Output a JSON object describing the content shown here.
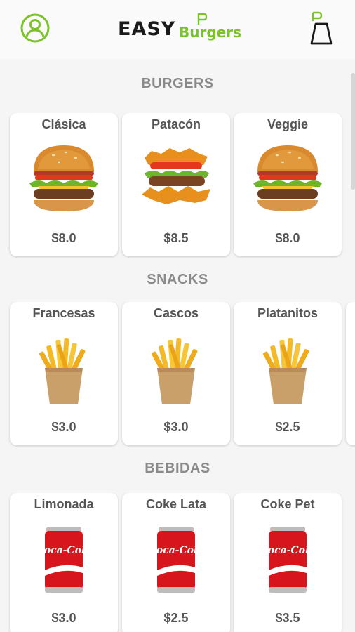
{
  "header": {
    "logo_easy": "EASY",
    "logo_burgers": "Burgers",
    "logo_mark": "P",
    "profile_icon": "user-circle-icon",
    "cart_icon": "cart-bag-icon",
    "accent_color": "#7cc22a"
  },
  "sections": [
    {
      "title": "BURGERS",
      "items": [
        {
          "name": "Clásica",
          "price": "$8.0",
          "icon": "burger-icon"
        },
        {
          "name": "Patacón",
          "price": "$8.5",
          "icon": "patacon-burger-icon"
        },
        {
          "name": "Veggie",
          "price": "$8.0",
          "icon": "burger-icon"
        }
      ]
    },
    {
      "title": "SNACKS",
      "items": [
        {
          "name": "Francesas",
          "price": "$3.0",
          "icon": "fries-icon"
        },
        {
          "name": "Cascos",
          "price": "$3.0",
          "icon": "fries-icon"
        },
        {
          "name": "Platanitos",
          "price": "$2.5",
          "icon": "fries-icon"
        }
      ]
    },
    {
      "title": "BEBIDAS",
      "items": [
        {
          "name": "Limonada",
          "price": "$3.0",
          "icon": "soda-can-icon"
        },
        {
          "name": "Coke Lata",
          "price": "$2.5",
          "icon": "soda-can-icon"
        },
        {
          "name": "Coke Pet",
          "price": "$3.5",
          "icon": "soda-can-icon"
        }
      ]
    }
  ]
}
